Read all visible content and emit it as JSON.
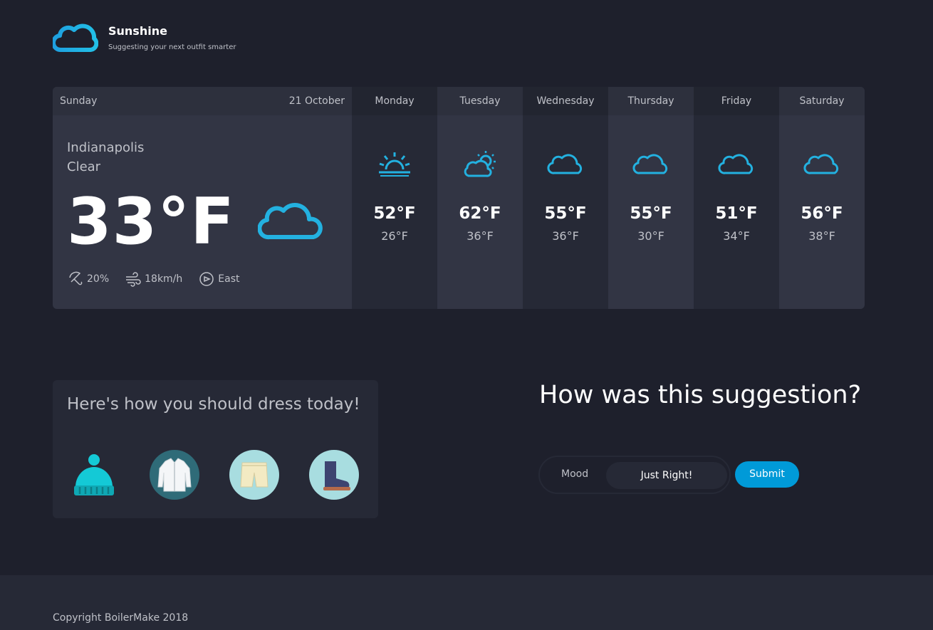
{
  "brand": {
    "title": "Sunshine",
    "tagline": "Suggesting your next outfit smarter",
    "logo_icon": "cloud-icon",
    "accent_color": "#23b1e0"
  },
  "today": {
    "day": "Sunday",
    "date": "21 October",
    "city": "Indianapolis",
    "condition": "Clear",
    "temp": "33°F",
    "icon": "cloud-icon",
    "precipitation": "20%",
    "wind_speed": "18km/h",
    "wind_direction": "East"
  },
  "forecast": [
    {
      "day": "Monday",
      "high": "52°F",
      "low": "26°F",
      "icon": "sunrise-icon"
    },
    {
      "day": "Tuesday",
      "high": "62°F",
      "low": "36°F",
      "icon": "partly-cloudy-icon"
    },
    {
      "day": "Wednesday",
      "high": "55°F",
      "low": "36°F",
      "icon": "cloud-icon"
    },
    {
      "day": "Thursday",
      "high": "55°F",
      "low": "30°F",
      "icon": "cloud-icon"
    },
    {
      "day": "Friday",
      "high": "51°F",
      "low": "34°F",
      "icon": "cloud-icon"
    },
    {
      "day": "Saturday",
      "high": "56°F",
      "low": "38°F",
      "icon": "cloud-icon"
    }
  ],
  "outfit": {
    "title": "Here's how you should dress today!",
    "items": [
      "beanie-icon",
      "jacket-icon",
      "shorts-icon",
      "boot-icon"
    ]
  },
  "feedback": {
    "title": "How was this suggestion?",
    "mood_label": "Mood",
    "mood_value": "Just Right!",
    "submit_label": "Submit"
  },
  "footer": {
    "copyright": "Copyright BoilerMake 2018"
  }
}
